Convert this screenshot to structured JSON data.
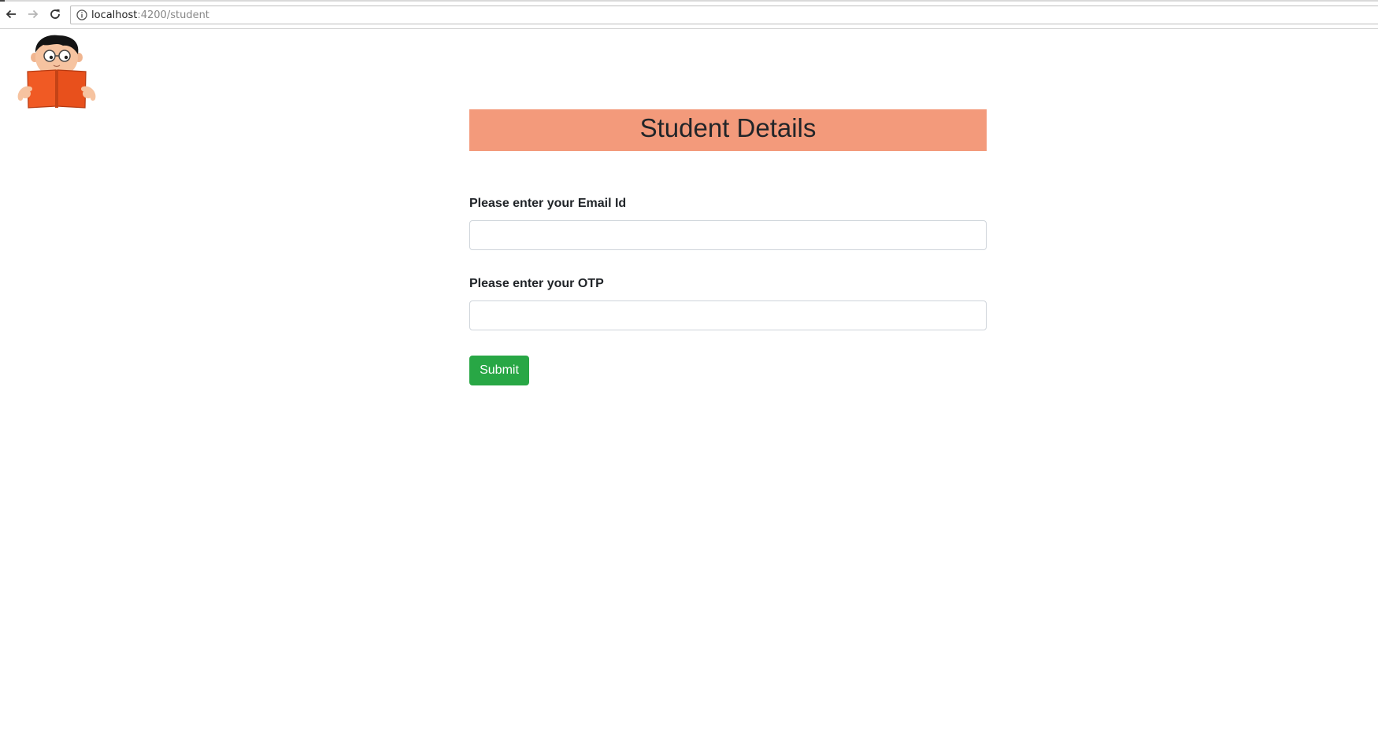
{
  "browser": {
    "url_host": "localhost",
    "url_path": ":4200/student",
    "icons": [
      "back-arrow-icon",
      "forward-arrow-icon",
      "reload-icon",
      "info-icon"
    ]
  },
  "page": {
    "logo_icon": "student-reading-book-avatar",
    "title": "Student Details",
    "header_color": "#f39a7b"
  },
  "form": {
    "email_label": "Please enter your Email Id",
    "email_value": "",
    "otp_label": "Please enter your OTP",
    "otp_value": "",
    "submit_label": "Submit",
    "submit_color": "#28a745"
  }
}
